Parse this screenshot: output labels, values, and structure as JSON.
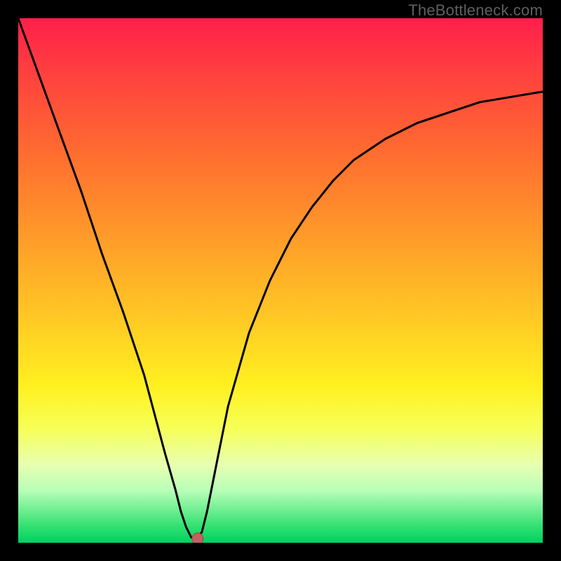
{
  "watermark": "TheBottleneck.com",
  "marker": {
    "x_ratio": 0.342,
    "y_ratio": 0.992,
    "radius_px": 8
  },
  "colors": {
    "frame": "#000000",
    "curve": "#000000",
    "dot_fill": "#c46060",
    "dot_stroke": "#a04848",
    "gradient_top": "#ff1f4a",
    "gradient_bottom": "#00d060",
    "watermark": "#5f5f5f"
  },
  "chart_data": {
    "type": "line",
    "title": "",
    "xlabel": "",
    "ylabel": "",
    "xlim": [
      0,
      100
    ],
    "ylim": [
      0,
      100
    ],
    "note": "x is a normalized horizontal axis; y is height as percent of plot (0=bottom, 100=top). Values estimated from pixels; curve is a V-shape bottoming near x≈33.",
    "x": [
      0,
      4,
      8,
      12,
      16,
      20,
      24,
      28,
      30,
      31,
      32,
      33,
      34,
      35,
      36,
      38,
      40,
      44,
      48,
      52,
      56,
      60,
      64,
      70,
      76,
      82,
      88,
      94,
      100
    ],
    "values": [
      100,
      89,
      78,
      67,
      55,
      44,
      32,
      17,
      10,
      6,
      3,
      1,
      1,
      2,
      6,
      16,
      26,
      40,
      50,
      58,
      64,
      69,
      73,
      77,
      80,
      82,
      84,
      85,
      86
    ],
    "marker_point": {
      "x": 34.2,
      "y": 0.8
    }
  }
}
